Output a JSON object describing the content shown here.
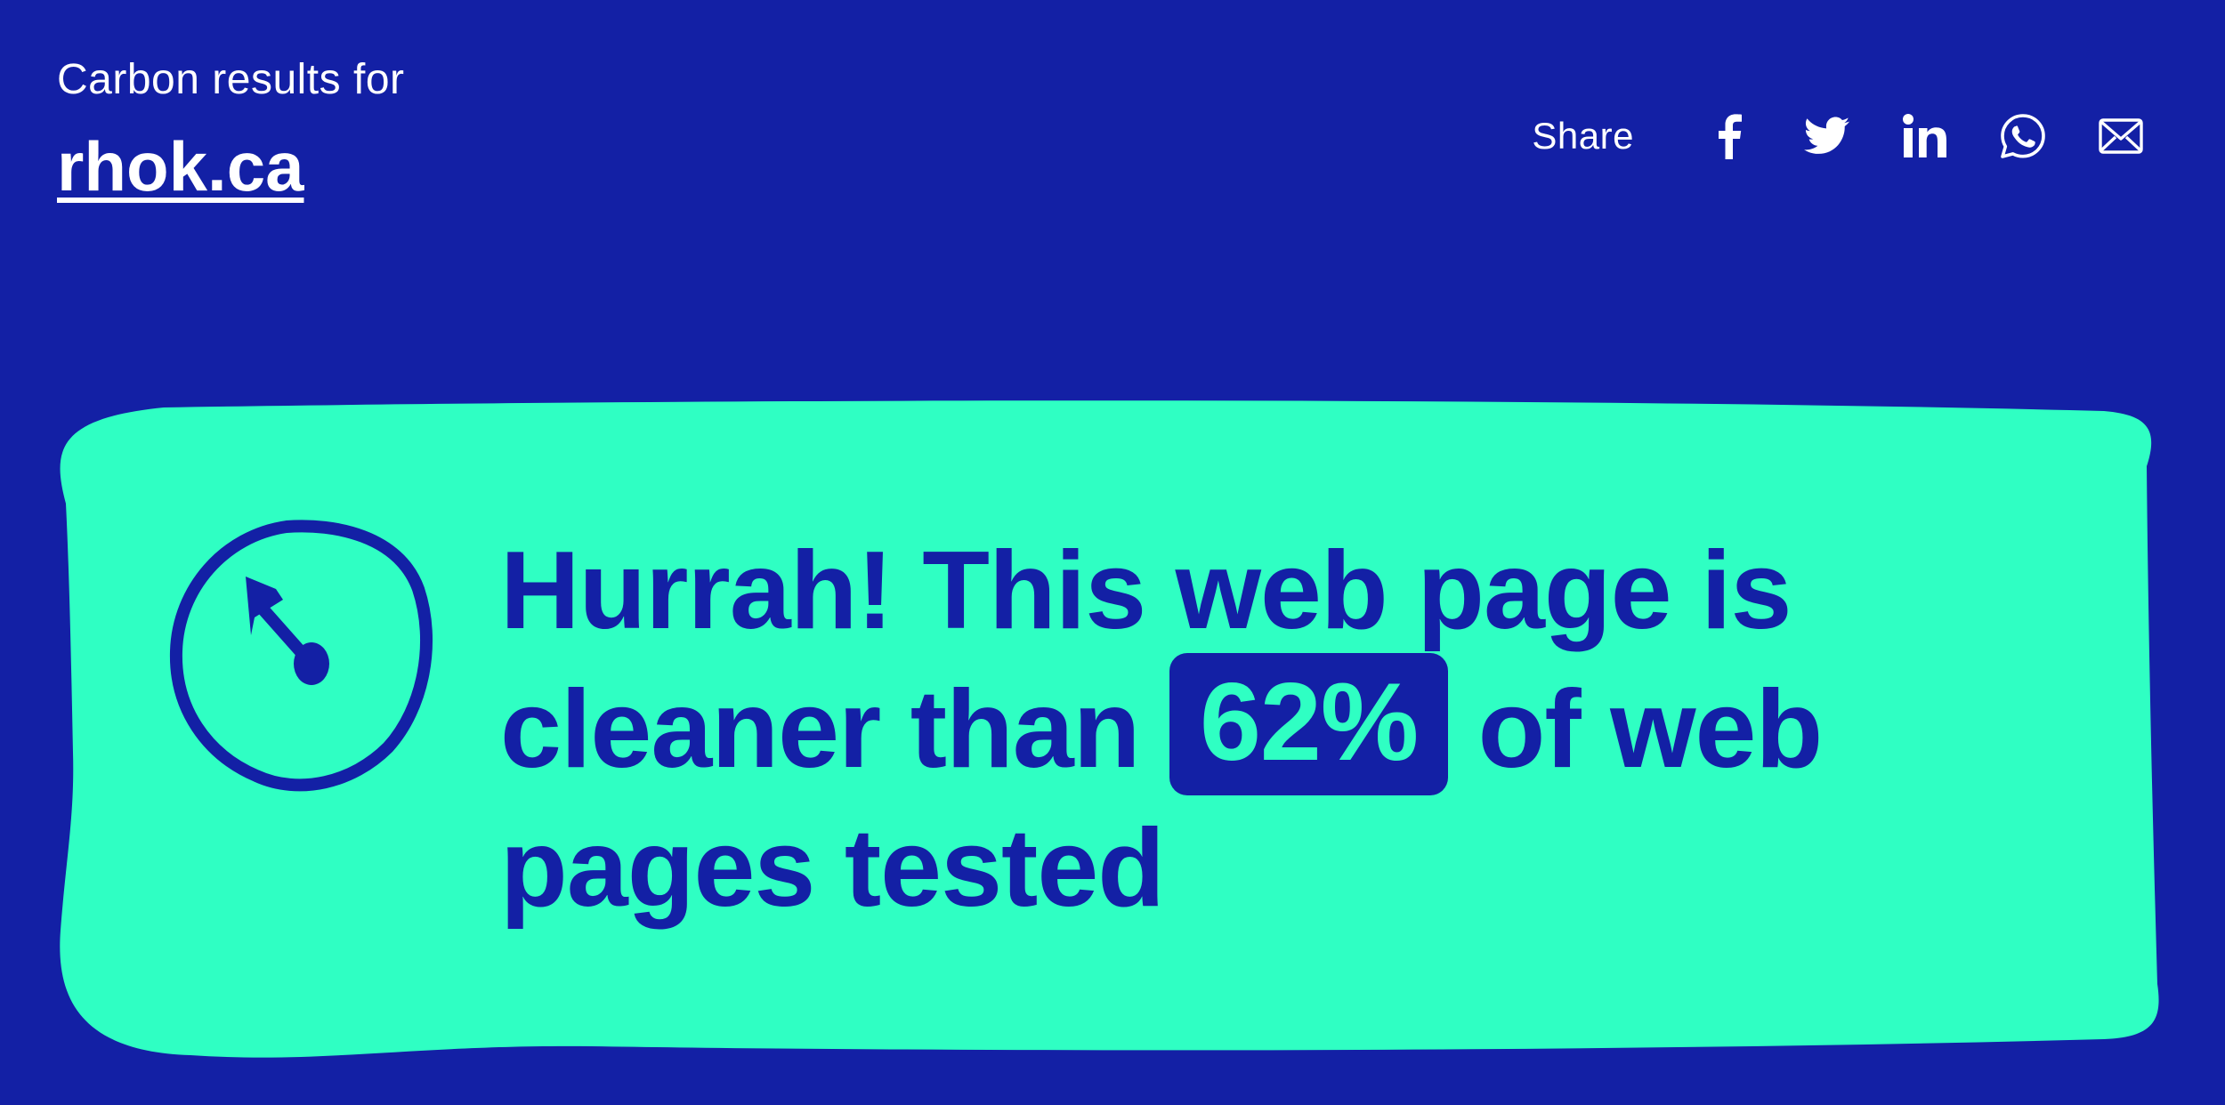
{
  "header": {
    "subtitle": "Carbon results for",
    "site": "rhok.ca"
  },
  "share": {
    "label": "Share",
    "icons": [
      "facebook-icon",
      "twitter-icon",
      "linkedin-icon",
      "whatsapp-icon",
      "email-icon"
    ]
  },
  "result": {
    "line_prefix": "Hurrah! This web page is cleaner than",
    "percent": "62%",
    "line_suffix": "of web pages tested",
    "cleaner_than_fraction": 0.62,
    "icon": "gauge-icon"
  },
  "colors": {
    "background": "#1320A5",
    "card": "#2FFFC3",
    "text_light": "#FFFFFF",
    "text_dark": "#1320A5"
  }
}
